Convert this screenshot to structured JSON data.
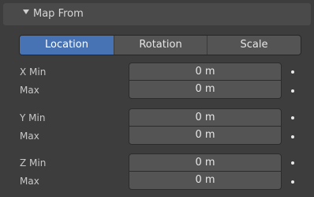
{
  "panel": {
    "title": "Map From",
    "collapsed": false
  },
  "mapping_mode": {
    "options": [
      "Location",
      "Rotation",
      "Scale"
    ],
    "selected": "Location"
  },
  "ranges": [
    {
      "min_label": "X Min",
      "max_label": "Max",
      "min_value": "0 m",
      "max_value": "0 m"
    },
    {
      "min_label": "Y Min",
      "max_label": "Max",
      "min_value": "0 m",
      "max_value": "0 m"
    },
    {
      "min_label": "Z Min",
      "max_label": "Max",
      "min_value": "0 m",
      "max_value": "0 m"
    }
  ],
  "colors": {
    "background": "#3d3d3d",
    "header": "#4a4a4a",
    "field": "#545454",
    "accent": "#4772b3"
  }
}
